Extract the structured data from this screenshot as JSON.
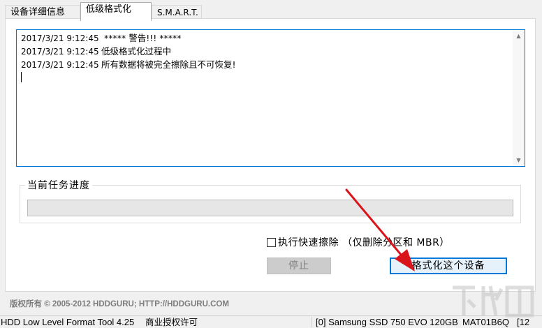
{
  "tabs": [
    {
      "label": "设备详细信息",
      "active": false
    },
    {
      "label": "低级格式化",
      "active": true
    },
    {
      "label": "S.M.A.R.T.",
      "active": false
    }
  ],
  "log": {
    "lines": [
      {
        "time": "2017/3/21 9:12:45",
        "message": " ***** 警告!!! *****"
      },
      {
        "time": "2017/3/21 9:12:45",
        "message": "低级格式化过程中"
      },
      {
        "time": "2017/3/21 9:12:45",
        "message": "所有数据将被完全擦除且不可恢复!"
      }
    ]
  },
  "progress": {
    "title": "当前任务进度",
    "value_fraction": 0
  },
  "quick_wipe": {
    "label": "执行快速擦除 （仅删除分区和 MBR）",
    "checked": false
  },
  "buttons": {
    "stop_label": "停止",
    "format_label": "格式化这个设备"
  },
  "copyright": "版权所有 © 2005-2012 HDDGURU; HTTP://HDDGURU.COM",
  "statusbar": {
    "app": "HDD Low Level Format Tool 4.25",
    "license": "商业授权许可",
    "device": "[0]  Samsung SSD 750 EVO 120GB",
    "serial": "MAT01B6Q",
    "extra": "[12"
  },
  "colors": {
    "accent": "#0078d7",
    "annotation_arrow": "#d9141b"
  },
  "icons": {
    "scroll_up": "arrow-up-icon",
    "scroll_down": "arrow-down-icon"
  }
}
